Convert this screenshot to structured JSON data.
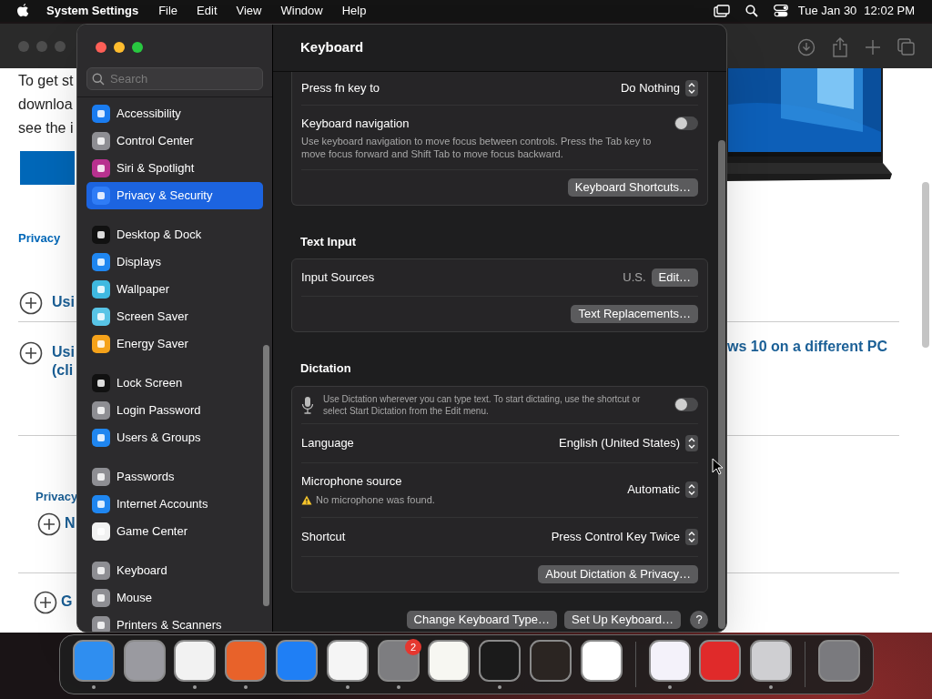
{
  "menu_bar": {
    "app": "System Settings",
    "menus": [
      "File",
      "Edit",
      "View",
      "Window",
      "Help"
    ],
    "date": "Tue Jan 30",
    "time": "12:02 PM"
  },
  "browser": {
    "left_texts": [
      "To get st",
      "downloa",
      "see the i"
    ],
    "left_link": "Privacy",
    "left_items": [
      {
        "lines": [
          "Usi"
        ]
      },
      {
        "lines": [
          "Usi",
          "(cli"
        ]
      }
    ],
    "left_link_2": "Privacy",
    "left_items_2": [
      {
        "lines": [
          "N"
        ]
      },
      {
        "lines": [
          "G"
        ]
      }
    ],
    "right_heading": "ws 10 on a different PC"
  },
  "settings": {
    "title": "Keyboard",
    "search_placeholder": "Search",
    "sidebar_groups": [
      {
        "items": [
          {
            "label": "Accessibility",
            "color": "#1a7cf0",
            "selected": false
          },
          {
            "label": "Control Center",
            "color": "#8e8e93",
            "selected": false
          },
          {
            "label": "Siri & Spotlight",
            "color": "#b8318f",
            "selected": false
          },
          {
            "label": "Privacy & Security",
            "color": "#2f7cf6",
            "selected": true
          }
        ]
      },
      {
        "items": [
          {
            "label": "Desktop & Dock",
            "color": "#111111",
            "selected": false
          },
          {
            "label": "Displays",
            "color": "#1f86f0",
            "selected": false
          },
          {
            "label": "Wallpaper",
            "color": "#3fb9e0",
            "selected": false
          },
          {
            "label": "Screen Saver",
            "color": "#58c4e6",
            "selected": false
          },
          {
            "label": "Energy Saver",
            "color": "#f5a21a",
            "selected": false
          }
        ]
      },
      {
        "items": [
          {
            "label": "Lock Screen",
            "color": "#111111",
            "selected": false
          },
          {
            "label": "Login Password",
            "color": "#8e8e93",
            "selected": false
          },
          {
            "label": "Users & Groups",
            "color": "#1f86f0",
            "selected": false
          }
        ]
      },
      {
        "items": [
          {
            "label": "Passwords",
            "color": "#8e8e93",
            "selected": false
          },
          {
            "label": "Internet Accounts",
            "color": "#1f86f0",
            "selected": false
          },
          {
            "label": "Game Center",
            "color": "#f2f2f2",
            "selected": false
          }
        ]
      },
      {
        "items": [
          {
            "label": "Keyboard",
            "color": "#8e8e93",
            "selected": false
          },
          {
            "label": "Mouse",
            "color": "#8e8e93",
            "selected": false
          },
          {
            "label": "Printers & Scanners",
            "color": "#8e8e93",
            "selected": false
          }
        ]
      }
    ],
    "cards": [
      {
        "rows": [
          {
            "kind": "popup",
            "label": "Press fn key to",
            "value": "Do Nothing"
          },
          {
            "kind": "toggle",
            "label": "Keyboard navigation",
            "description": "Use keyboard navigation to move focus between controls. Press the Tab key to move focus forward and Shift Tab to move focus backward.",
            "on": false
          },
          {
            "kind": "button",
            "button": "Keyboard Shortcuts…"
          }
        ]
      },
      {
        "heading": "Text Input",
        "rows": [
          {
            "kind": "value_button",
            "label": "Input Sources",
            "value": "U.S.",
            "button": "Edit…"
          },
          {
            "kind": "button",
            "button": "Text Replacements…"
          }
        ]
      },
      {
        "heading": "Dictation",
        "rows": [
          {
            "kind": "mic_toggle",
            "description": "Use Dictation wherever you can type text. To start dictating, use the shortcut or select Start Dictation from the Edit menu.",
            "on": false
          },
          {
            "kind": "popup",
            "label": "Language",
            "value": "English (United States)"
          },
          {
            "kind": "popup",
            "label": "Microphone source",
            "value": "Automatic",
            "warning": "No microphone was found."
          },
          {
            "kind": "popup",
            "label": "Shortcut",
            "value": "Press Control Key Twice"
          },
          {
            "kind": "button",
            "button": "About Dictation & Privacy…"
          }
        ]
      }
    ],
    "footer_buttons": [
      "Change Keyboard Type…",
      "Set Up Keyboard…"
    ],
    "help": "?"
  },
  "dock": {
    "groups": [
      [
        {
          "color": "#2f8ef0",
          "running": true
        },
        {
          "color": "#9a9aa0",
          "running": false
        },
        {
          "color": "#f2f2f2",
          "running": true
        },
        {
          "color": "#e8622a",
          "running": true
        },
        {
          "color": "#1f7ff5",
          "running": false
        },
        {
          "color": "#f5f5f5",
          "running": true
        },
        {
          "color": "#7d7d80",
          "running": true,
          "badge": "2"
        },
        {
          "color": "#f7f7f2",
          "running": false
        },
        {
          "color": "#1b1b1b",
          "running": true
        },
        {
          "color": "#2b2522",
          "running": false
        },
        {
          "color": "#ffffff",
          "running": false
        }
      ],
      [
        {
          "color": "#f4f2fa",
          "running": true
        },
        {
          "color": "#e02a2a",
          "running": false
        },
        {
          "color": "#cfcfd2",
          "running": true
        }
      ],
      [
        {
          "color": "#7a7a7e",
          "running": false
        }
      ]
    ]
  }
}
